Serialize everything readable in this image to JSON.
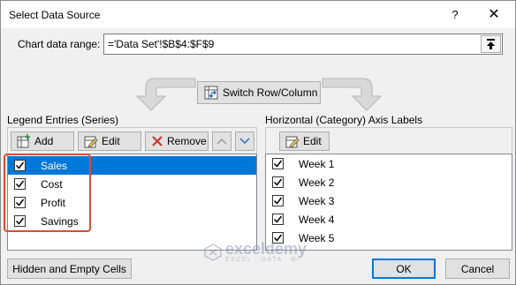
{
  "dialog": {
    "title": "Select Data Source",
    "help_label": "?",
    "close_label": "✕"
  },
  "range": {
    "label": "Chart data range:",
    "value": "='Data Set'!$B$4:$F$9"
  },
  "switch_button": {
    "label": "Switch Row/Column"
  },
  "legend": {
    "label": "Legend Entries (Series)",
    "add_label": "Add",
    "edit_label": "Edit",
    "remove_label": "Remove",
    "items": [
      {
        "label": "Sales",
        "checked": true,
        "selected": true
      },
      {
        "label": "Cost",
        "checked": true,
        "selected": false
      },
      {
        "label": "Profit",
        "checked": true,
        "selected": false
      },
      {
        "label": "Savings",
        "checked": true,
        "selected": false
      }
    ]
  },
  "axis": {
    "label": "Horizontal (Category) Axis Labels",
    "edit_label": "Edit",
    "items": [
      {
        "label": "Week 1",
        "checked": true
      },
      {
        "label": "Week 2",
        "checked": true
      },
      {
        "label": "Week 3",
        "checked": true
      },
      {
        "label": "Week 4",
        "checked": true
      },
      {
        "label": "Week 5",
        "checked": true
      }
    ]
  },
  "footer": {
    "hidden_cells_label": "Hidden and Empty Cells",
    "ok_label": "OK",
    "cancel_label": "Cancel"
  },
  "watermark": {
    "title": "exceldemy",
    "subtitle": "EXCEL · DATA · BI"
  },
  "colors": {
    "selection": "#0078d7",
    "highlight": "#e04b32",
    "remove_icon": "#d32f2f",
    "arrow_button": "#3c78c8"
  }
}
